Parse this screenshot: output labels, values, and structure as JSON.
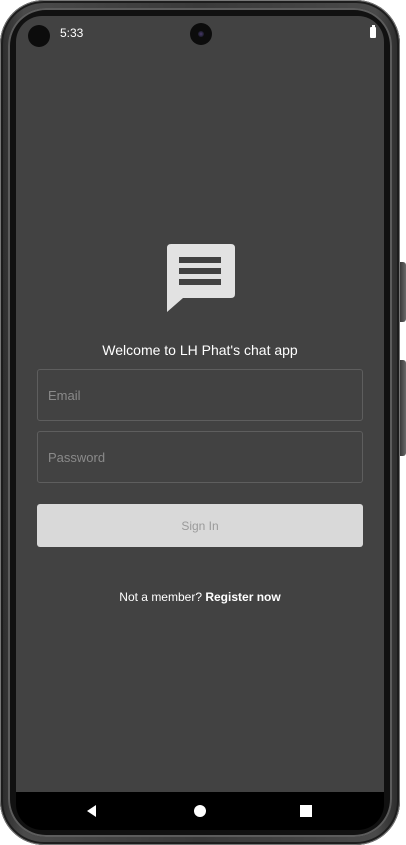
{
  "status_bar": {
    "time": "5:33",
    "icons": [
      "camera-icon",
      "battery-icon"
    ]
  },
  "logo": {
    "icon": "chat-bubble-icon",
    "color": "#e2e2e2"
  },
  "welcome_text": "Welcome to LH Phat's chat app",
  "email": {
    "placeholder": "Email",
    "value": ""
  },
  "password": {
    "placeholder": "Password",
    "value": ""
  },
  "sign_in_label": "Sign In",
  "register": {
    "prompt": "Not a member?",
    "link": "Register now"
  },
  "nav_bar": {
    "icons": [
      "back-icon",
      "home-icon",
      "recents-icon"
    ]
  },
  "colors": {
    "screen_background": "#424242",
    "button_background": "#d9d9d9",
    "button_text": "#9a9a9a",
    "text": "#ffffff"
  }
}
